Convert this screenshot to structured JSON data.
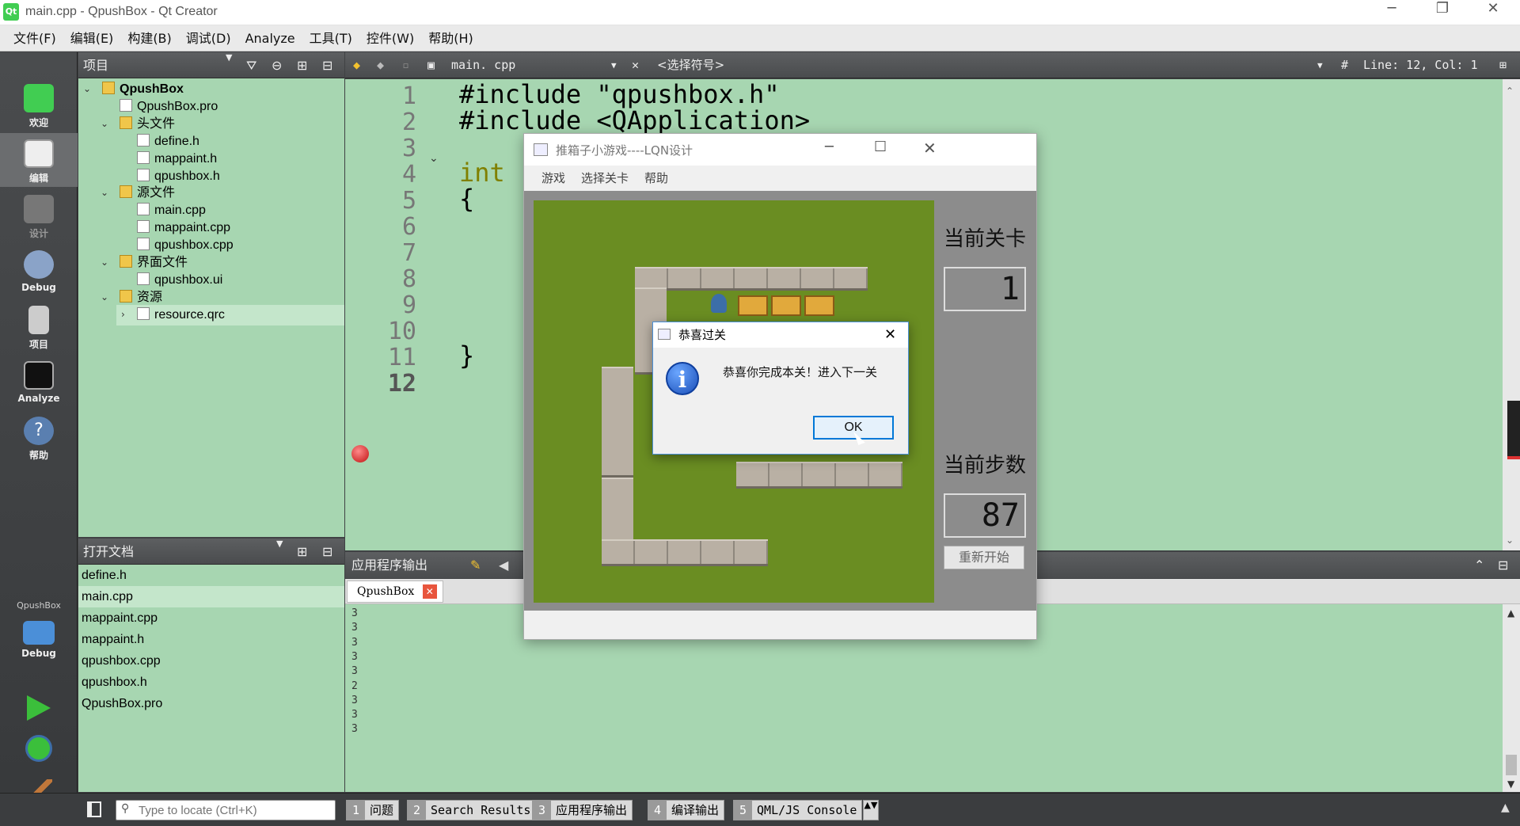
{
  "window": {
    "title": "main.cpp - QpushBox - Qt Creator",
    "min": "─",
    "restore": "❐",
    "close": "✕"
  },
  "menu": [
    "文件(F)",
    "编辑(E)",
    "构建(B)",
    "调试(D)",
    "Analyze",
    "工具(T)",
    "控件(W)",
    "帮助(H)"
  ],
  "modes": [
    {
      "label": "欢迎",
      "icon": "qt-logo-icon"
    },
    {
      "label": "编辑",
      "icon": "edit-icon"
    },
    {
      "label": "设计",
      "icon": "design-icon"
    },
    {
      "label": "Debug",
      "icon": "debug-icon"
    },
    {
      "label": "项目",
      "icon": "project-icon"
    },
    {
      "label": "Analyze",
      "icon": "analyze-icon"
    },
    {
      "label": "帮助",
      "icon": "help-icon"
    }
  ],
  "kit": {
    "name": "QpushBox",
    "label": "Debug"
  },
  "project_panel": {
    "title": "项目",
    "tree": [
      {
        "label": "QpushBox",
        "depth": 0,
        "bold": true
      },
      {
        "label": "QpushBox.pro",
        "depth": 1
      },
      {
        "label": "头文件",
        "depth": 1
      },
      {
        "label": "define.h",
        "depth": 2
      },
      {
        "label": "mappaint.h",
        "depth": 2
      },
      {
        "label": "qpushbox.h",
        "depth": 2
      },
      {
        "label": "源文件",
        "depth": 1
      },
      {
        "label": "main.cpp",
        "depth": 2
      },
      {
        "label": "mappaint.cpp",
        "depth": 2
      },
      {
        "label": "qpushbox.cpp",
        "depth": 2
      },
      {
        "label": "界面文件",
        "depth": 1
      },
      {
        "label": "qpushbox.ui",
        "depth": 2
      },
      {
        "label": "资源",
        "depth": 1
      },
      {
        "label": "resource.qrc",
        "depth": 2
      }
    ]
  },
  "open_docs": {
    "title": "打开文档",
    "items": [
      "define.h",
      "main.cpp",
      "mappaint.cpp",
      "mappaint.h",
      "qpushbox.cpp",
      "qpushbox.h",
      "QpushBox.pro"
    ]
  },
  "editor": {
    "file": "main. cpp",
    "symbol": "<选择符号>",
    "position": "Line: 12, Col: 1",
    "hash": "#",
    "lines": [
      "1",
      "2",
      "3",
      "4",
      "5",
      "6",
      "7",
      "8",
      "9",
      "10",
      "11",
      "12"
    ],
    "code": [
      "#include \"qpushbox.h\"",
      "#include <QApplication>",
      "",
      "int",
      "{",
      "",
      "",
      "",
      "",
      "",
      "}",
      ""
    ]
  },
  "output": {
    "title": "应用程序输出",
    "tab": "QpushBox",
    "lines": [
      "3",
      "3",
      "3",
      "3",
      "3",
      "2",
      "3",
      "3",
      "3"
    ]
  },
  "statusbar": {
    "locate_placeholder": "Type to locate (Ctrl+K)",
    "tabs": [
      {
        "n": "1",
        "label": "问题"
      },
      {
        "n": "2",
        "label": "Search Results"
      },
      {
        "n": "3",
        "label": "应用程序输出"
      },
      {
        "n": "4",
        "label": "编译输出"
      },
      {
        "n": "5",
        "label": "QML/JS Console"
      }
    ]
  },
  "game": {
    "title": "推箱子小游戏----LQN设计",
    "menu": [
      "游戏",
      "选择关卡",
      "帮助"
    ],
    "level_label": "当前关卡",
    "level_value": "1",
    "steps_label": "当前步数",
    "steps_value": "87",
    "restart": "重新开始"
  },
  "dialog": {
    "title": "恭喜过关",
    "message": "恭喜你完成本关！进入下一关",
    "ok": "OK",
    "close": "✕"
  }
}
